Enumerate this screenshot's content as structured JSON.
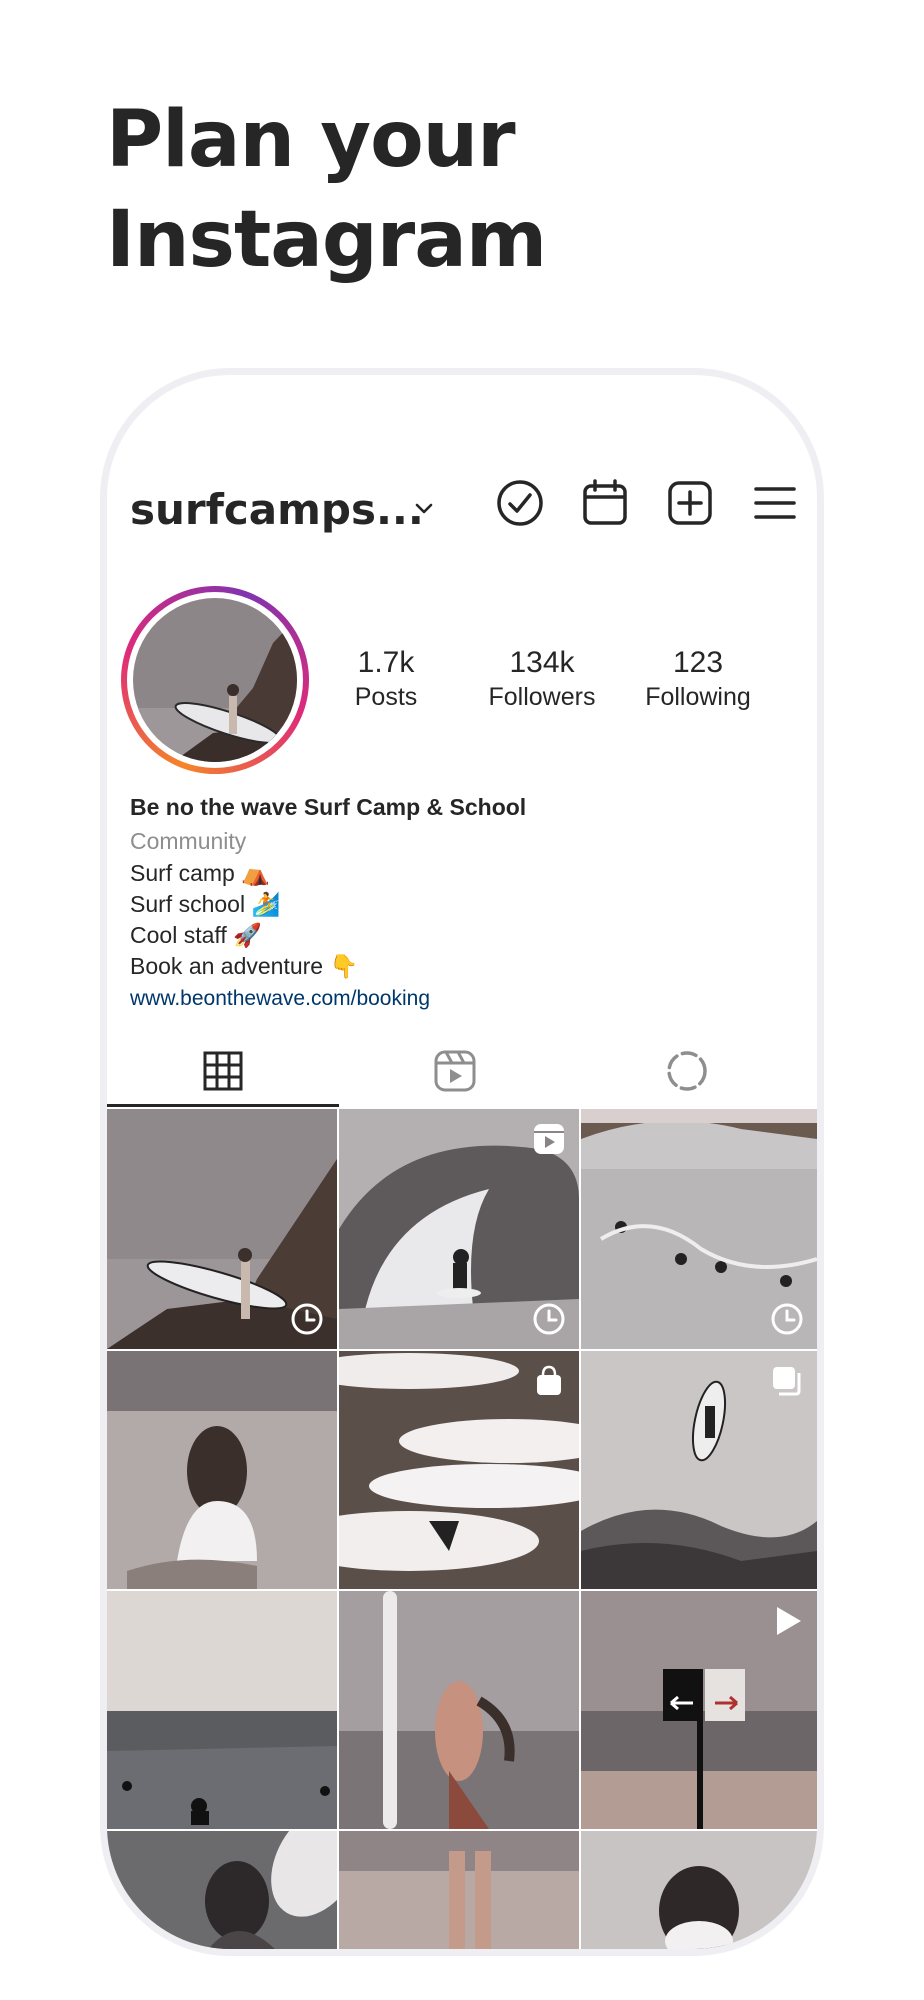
{
  "headline": {
    "line1": "Plan your",
    "line2": "Instagram"
  },
  "profile": {
    "username": "surfcamps...",
    "stats": [
      {
        "value": "1.7k",
        "label": "Posts"
      },
      {
        "value": "134k",
        "label": "Followers"
      },
      {
        "value": "123",
        "label": "Following"
      }
    ],
    "bio": {
      "name": "Be no the wave Surf Camp & School",
      "category": "Community",
      "lines": [
        "Surf camp ⛺",
        "Surf school 🏄",
        "Cool staff 🚀",
        "Book an adventure 👇"
      ],
      "link": "www.beonthewave.com/booking"
    }
  },
  "toolbar_icons": [
    "check-circle-icon",
    "calendar-icon",
    "add-square-icon",
    "menu-icon"
  ],
  "tabs": [
    "grid-icon",
    "reels-icon",
    "stories-icon"
  ],
  "grid_badges": [
    "clock-icon",
    "reels-clock-icon",
    "clock-icon",
    "none",
    "shop-icon",
    "carousel-icon",
    "none",
    "none",
    "play-icon"
  ],
  "colors": {
    "link": "#00376b",
    "ring_start": "#f58529",
    "ring_end": "#8134af"
  }
}
